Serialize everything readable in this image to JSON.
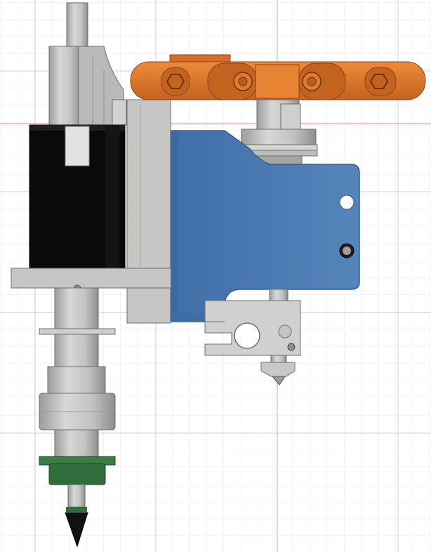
{
  "viewport": {
    "background": "#ffffff",
    "grid_minor_color": "#ececec",
    "grid_major_color": "#d2d2d2",
    "axis_x_color": "#e88b8b",
    "axis_y_color": "#8fd08f"
  },
  "parts": {
    "motor_color": "#0a0a0a",
    "frame_color": "#c4c4c2",
    "frame_shadow_color": "#a6a6a4",
    "housing_color": "#4a7ab0",
    "housing_edge_color": "#2e5c94",
    "cable_chain_color": "#e07a2e",
    "cable_chain_shadow": "#b95d1d",
    "seal_color": "#2f6e3a",
    "tip_color": "#111111"
  }
}
